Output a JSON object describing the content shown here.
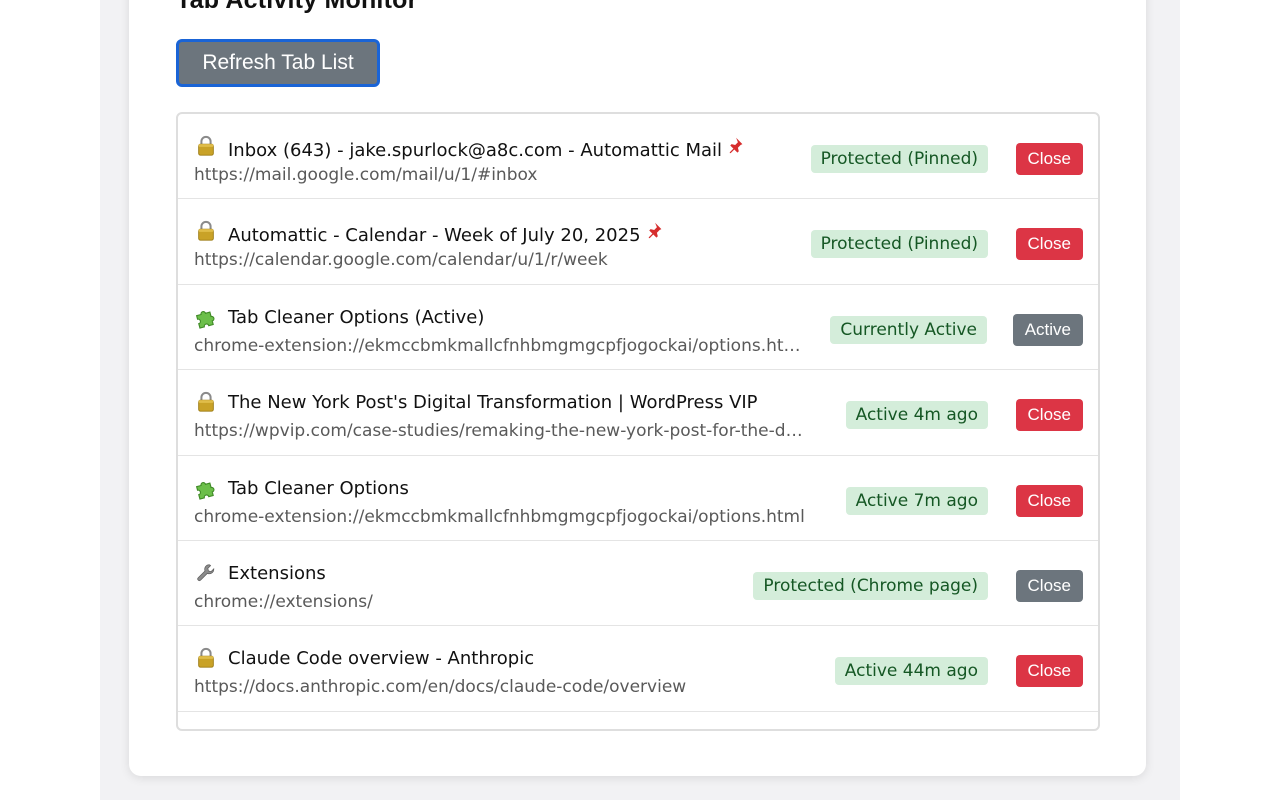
{
  "header": {
    "title": "Tab Activity Monitor",
    "refresh_label": "Refresh Tab List"
  },
  "colors": {
    "close_button": "#dc3545",
    "disabled_button": "#6c757d",
    "status_badge_bg": "#d4edda",
    "status_badge_text": "#155724"
  },
  "tabs": [
    {
      "icon": "lock-icon",
      "title": "Inbox (643) - jake.spurlock@a8c.com - Automattic Mail",
      "pinned": true,
      "url": "https://mail.google.com/mail/u/1/#inbox",
      "status": "Protected (Pinned)",
      "action": "Close",
      "action_style": "danger"
    },
    {
      "icon": "lock-icon",
      "title": "Automattic - Calendar - Week of July 20, 2025",
      "pinned": true,
      "url": "https://calendar.google.com/calendar/u/1/r/week",
      "status": "Protected (Pinned)",
      "action": "Close",
      "action_style": "danger"
    },
    {
      "icon": "puzzle-piece-icon",
      "title": "Tab Cleaner Options (Active)",
      "pinned": false,
      "url": "chrome-extension://ekmccbmkmallcfnhbmgmgcpfjogockai/options.ht…",
      "status": "Currently Active",
      "action": "Active",
      "action_style": "muted"
    },
    {
      "icon": "lock-icon",
      "title": "The New York Post's Digital Transformation | WordPress VIP",
      "pinned": false,
      "url": "https://wpvip.com/case-studies/remaking-the-new-york-post-for-the-d…",
      "status": "Active 4m ago",
      "action": "Close",
      "action_style": "danger"
    },
    {
      "icon": "puzzle-piece-icon",
      "title": "Tab Cleaner Options",
      "pinned": false,
      "url": "chrome-extension://ekmccbmkmallcfnhbmgmgcpfjogockai/options.html",
      "status": "Active 7m ago",
      "action": "Close",
      "action_style": "danger"
    },
    {
      "icon": "wrench-icon",
      "title": "Extensions",
      "pinned": false,
      "url": "chrome://extensions/",
      "status": "Protected (Chrome page)",
      "action": "Close",
      "action_style": "muted"
    },
    {
      "icon": "lock-icon",
      "title": "Claude Code overview - Anthropic",
      "pinned": false,
      "url": "https://docs.anthropic.com/en/docs/claude-code/overview",
      "status": "Active 44m ago",
      "action": "Close",
      "action_style": "danger"
    }
  ]
}
